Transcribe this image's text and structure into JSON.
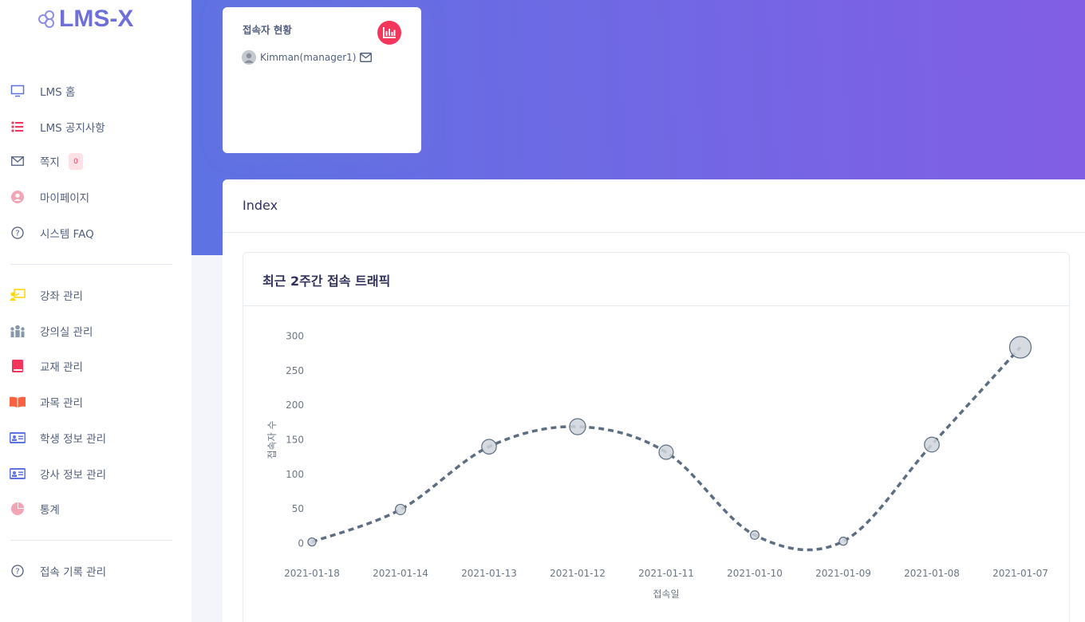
{
  "brand": {
    "name": "LMS-X"
  },
  "sidebar": {
    "items": [
      {
        "label": "LMS 홈",
        "icon": "monitor-icon"
      },
      {
        "label": "LMS 공지사항",
        "icon": "list-icon"
      },
      {
        "label": "쪽지",
        "icon": "envelope-icon",
        "badge": "0"
      },
      {
        "label": "마이페이지",
        "icon": "user-circle-icon"
      },
      {
        "label": "시스템 FAQ",
        "icon": "question-circle-icon"
      },
      {
        "label": "강좌 관리",
        "icon": "chalkboard-teacher-icon"
      },
      {
        "label": "강의실 관리",
        "icon": "people-group-icon"
      },
      {
        "label": "교재 관리",
        "icon": "book-icon"
      },
      {
        "label": "과목 관리",
        "icon": "book-open-icon"
      },
      {
        "label": "학생 정보 관리",
        "icon": "id-card-icon"
      },
      {
        "label": "강사 정보 관리",
        "icon": "id-card-icon"
      },
      {
        "label": "통계",
        "icon": "pie-chart-icon"
      },
      {
        "label": "접속 기록 관리",
        "icon": "question-circle-icon"
      }
    ]
  },
  "visitor": {
    "title": "접속자 현황",
    "icon": "chart-bar-icon",
    "user": "Kimman(manager1)"
  },
  "main": {
    "title": "Index"
  },
  "chart_card": {
    "title": "최근 2주간 접속 트래픽"
  },
  "colors": {
    "accent": "#5e72e4",
    "gradient_end": "#825ee4",
    "danger": "#f5365c",
    "line": "#5e6e82",
    "marker_fill": "#cfd5dc"
  },
  "chart_data": {
    "type": "scatter",
    "mode": "lines+markers",
    "line_shape": "spline",
    "line_dash": "dash",
    "categories": [
      "2021-01-18",
      "2021-01-14",
      "2021-01-13",
      "2021-01-12",
      "2021-01-11",
      "2021-01-10",
      "2021-01-09",
      "2021-01-08",
      "2021-01-07"
    ],
    "values": [
      2,
      49,
      140,
      169,
      132,
      12,
      3,
      143,
      284
    ],
    "marker_sizes": [
      2,
      49,
      140,
      169,
      132,
      12,
      3,
      143,
      284
    ],
    "xlabel": "접속일",
    "ylabel": "접속자 수",
    "yticks": [
      0,
      50,
      100,
      150,
      200,
      250,
      300
    ],
    "ylim": [
      -10,
      310
    ],
    "grid": false,
    "legend": false
  }
}
